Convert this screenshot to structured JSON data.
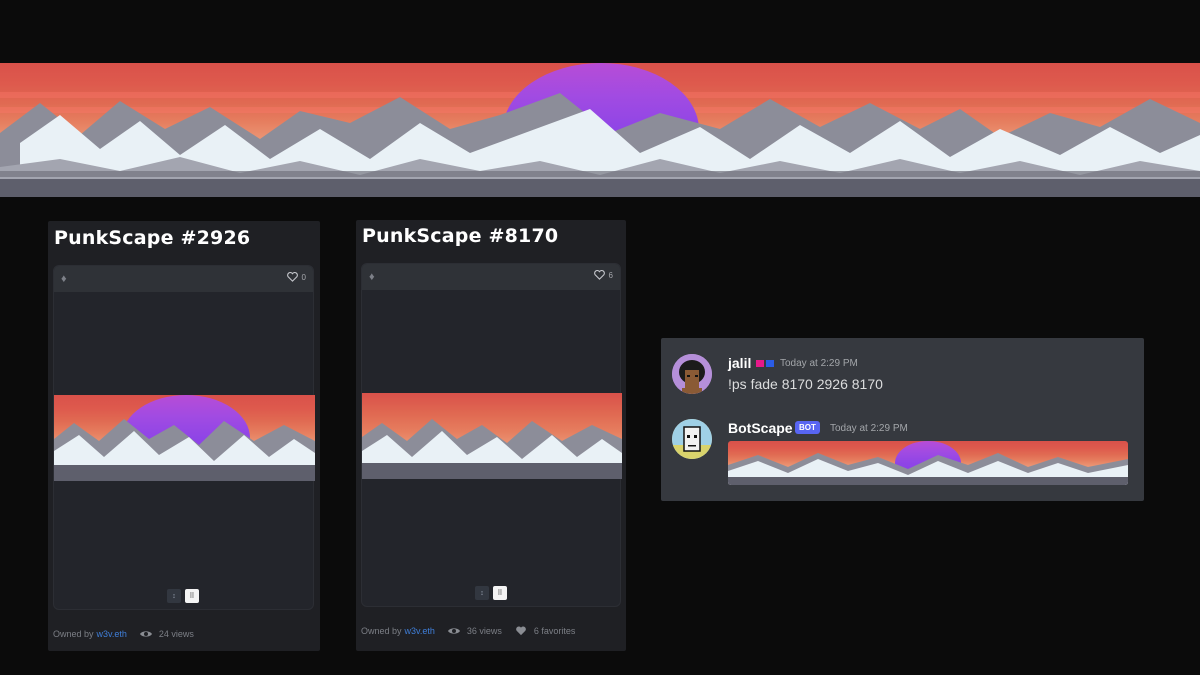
{
  "cards": [
    {
      "title": "PunkScape #2926",
      "favorites_count": "0",
      "owned_by_label": "Owned by",
      "owner": "w3v.eth",
      "views": "24 views",
      "pager": [
        "↕",
        "⠿"
      ]
    },
    {
      "title": "PunkScape #8170",
      "favorites_count": "6",
      "owned_by_label": "Owned by",
      "owner": "w3v.eth",
      "views": "36 views",
      "favorites": "6 favorites",
      "pager": [
        "↕",
        "⠿"
      ]
    }
  ],
  "discord": {
    "messages": [
      {
        "username": "jalil",
        "timestamp": "Today at 2:29 PM",
        "content": "!ps fade 8170 2926 8170",
        "badge_colors": [
          "#e6198a",
          "#2b5ce6"
        ]
      },
      {
        "username": "BotScape",
        "bot_tag": "BOT",
        "timestamp": "Today at 2:29 PM"
      }
    ]
  },
  "icons": {
    "eth": "ethereum-icon",
    "heart": "heart-icon",
    "eye": "eye-icon"
  },
  "colors": {
    "background": "#0b0b0b",
    "card": "#1f2024",
    "discord_bg": "#36393f",
    "link": "#3f7ed8",
    "bot_badge": "#5865f2",
    "sun": "#8f45e6"
  }
}
